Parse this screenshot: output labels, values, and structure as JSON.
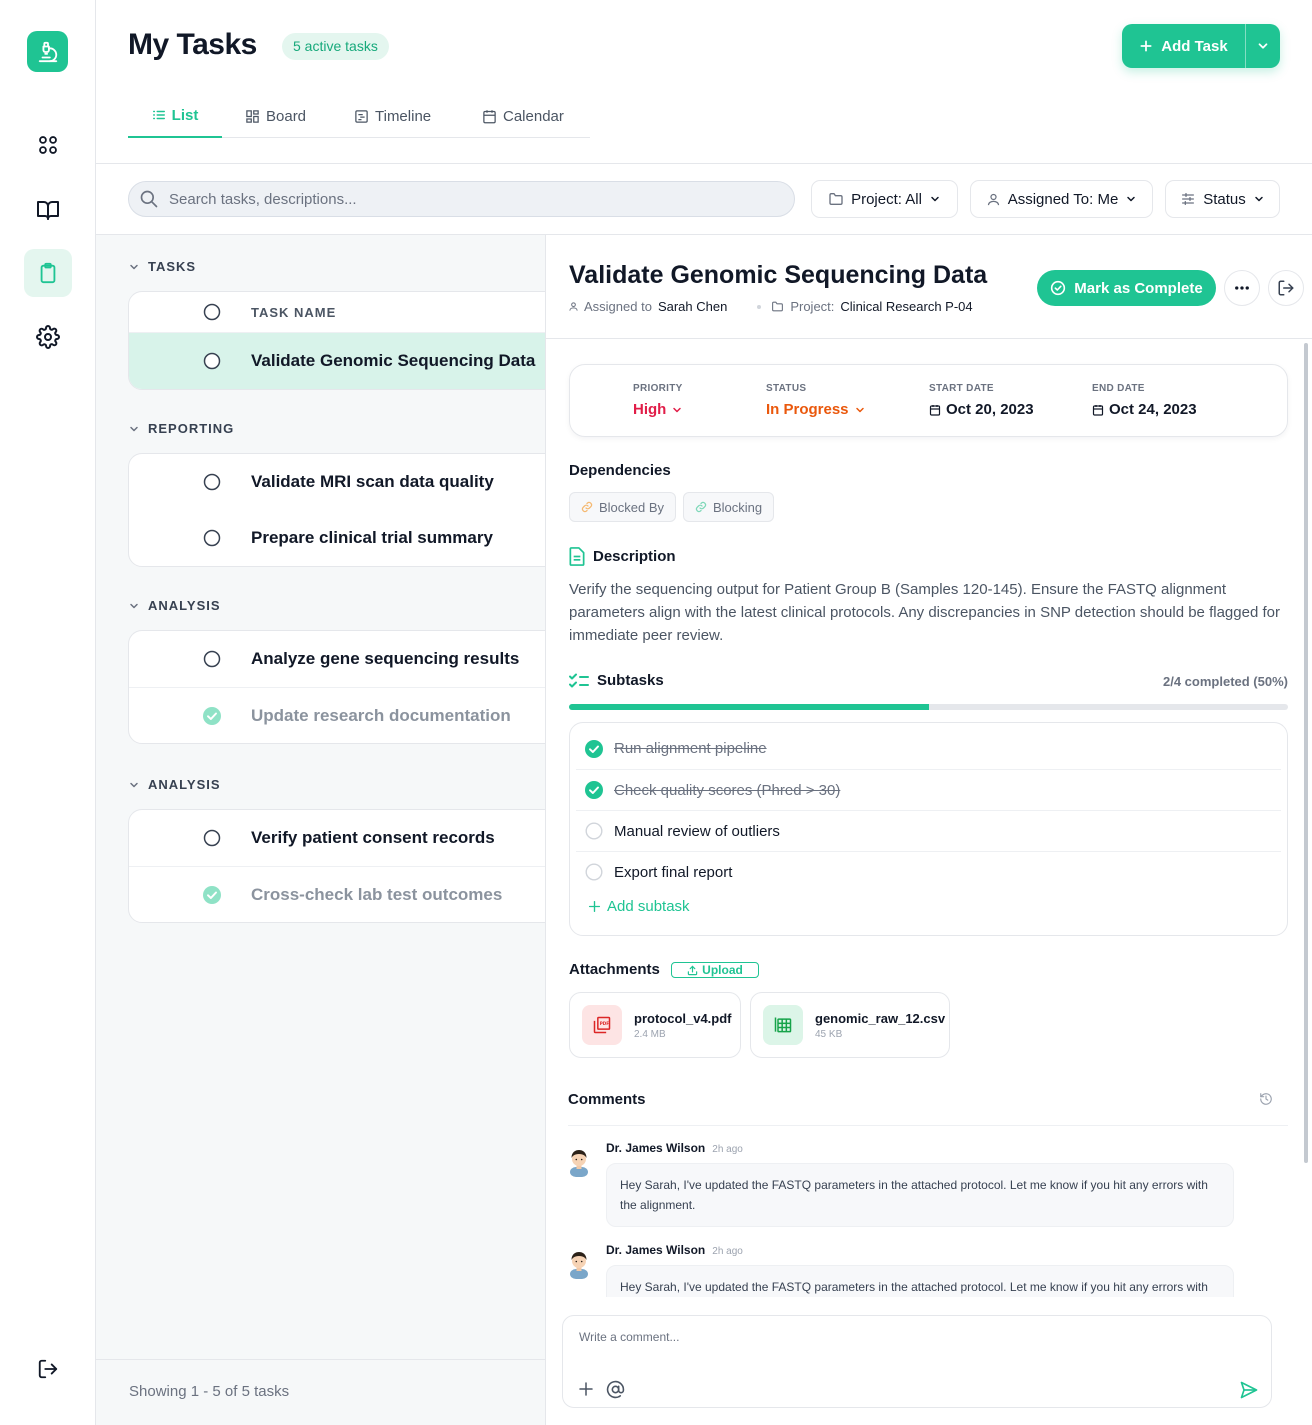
{
  "sidebar": {
    "logo_icon": "microscope-icon",
    "items": [
      {
        "icon": "grid-icon"
      },
      {
        "icon": "book-icon"
      },
      {
        "icon": "clipboard-icon",
        "active": true
      },
      {
        "icon": "gear-icon"
      }
    ],
    "logout_icon": "logout-icon"
  },
  "header": {
    "title": "My Tasks",
    "badge": "5 active tasks",
    "add_task_label": "Add Task",
    "tabs": [
      {
        "label": "List",
        "icon": "list-icon",
        "active": true
      },
      {
        "label": "Board",
        "icon": "board-icon"
      },
      {
        "label": "Timeline",
        "icon": "timeline-icon"
      },
      {
        "label": "Calendar",
        "icon": "calendar-icon"
      }
    ]
  },
  "filters": {
    "search_placeholder": "Search tasks, descriptions...",
    "project": "Project: All",
    "assigned": "Assigned To: Me",
    "status": "Status"
  },
  "task_list": {
    "groups": [
      {
        "label": "TASKS",
        "header": "TASK NAME",
        "tasks": [
          {
            "name": "Validate Genomic Sequencing Data",
            "done": false,
            "selected": true
          }
        ]
      },
      {
        "label": "REPORTING",
        "tasks": [
          {
            "name": "Validate MRI scan data quality",
            "done": false
          },
          {
            "name": "Prepare clinical trial summary",
            "done": false
          }
        ]
      },
      {
        "label": "ANALYSIS",
        "tasks": [
          {
            "name": "Analyze gene sequencing results",
            "done": false
          },
          {
            "name": "Update research documentation",
            "done": true
          }
        ]
      },
      {
        "label": "ANALYSIS",
        "tasks": [
          {
            "name": "Verify patient consent records",
            "done": false
          },
          {
            "name": "Cross-check lab test outcomes",
            "done": true
          }
        ]
      }
    ],
    "footer": "Showing 1 - 5 of 5 tasks"
  },
  "detail": {
    "title": "Validate Genomic Sequencing Data",
    "assigned_label": "Assigned to",
    "assignee": "Sarah Chen",
    "project_label": "Project:",
    "project": "Clinical Research P-04",
    "complete_label": "Mark as Complete",
    "meta": {
      "priority_label": "PRIORITY",
      "priority": "High",
      "status_label": "STATUS",
      "status": "In Progress",
      "start_label": "START DATE",
      "start": "Oct 20, 2023",
      "end_label": "END DATE",
      "end": "Oct 24, 2023"
    },
    "dependencies": {
      "title": "Dependencies",
      "blocked_by": "Blocked By",
      "blocking": "Blocking"
    },
    "description": {
      "title": "Description",
      "text": "Verify the sequencing output for Patient Group B (Samples 120-145). Ensure the FASTQ alignment parameters align with the latest clinical protocols. Any discrepancies in SNP detection should be flagged for immediate peer review."
    },
    "subtasks": {
      "title": "Subtasks",
      "count": "2/4 completed (50%)",
      "progress": 0.5,
      "items": [
        {
          "label": "Run alignment pipeline",
          "done": true
        },
        {
          "label": "Check quality scores (Phred > 30)",
          "done": true
        },
        {
          "label": "Manual review of outliers",
          "done": false
        },
        {
          "label": "Export final report",
          "done": false
        }
      ],
      "add_label": "Add subtask"
    },
    "attachments": {
      "title": "Attachments",
      "upload_label": "Upload",
      "files": [
        {
          "name": "protocol_v4.pdf",
          "size": "2.4 MB",
          "icon": "pdf-icon"
        },
        {
          "name": "genomic_raw_12.csv",
          "size": "45 KB",
          "icon": "spreadsheet-icon"
        }
      ]
    },
    "comments": {
      "title": "Comments",
      "items": [
        {
          "author": "Dr. James Wilson",
          "time": "2h ago",
          "text": "Hey Sarah, I've updated the FASTQ parameters in the attached protocol. Let me know if you hit any errors with the alignment."
        },
        {
          "author": "Dr. James Wilson",
          "time": "2h ago",
          "text": "Hey Sarah, I've updated the FASTQ parameters in the attached protocol. Let me know if you hit any errors with the alignment."
        }
      ],
      "placeholder": "Write a comment..."
    }
  },
  "colors": {
    "accent": "#1fc493",
    "priority_high": "#e11d48",
    "status_in_progress": "#ea580c"
  }
}
